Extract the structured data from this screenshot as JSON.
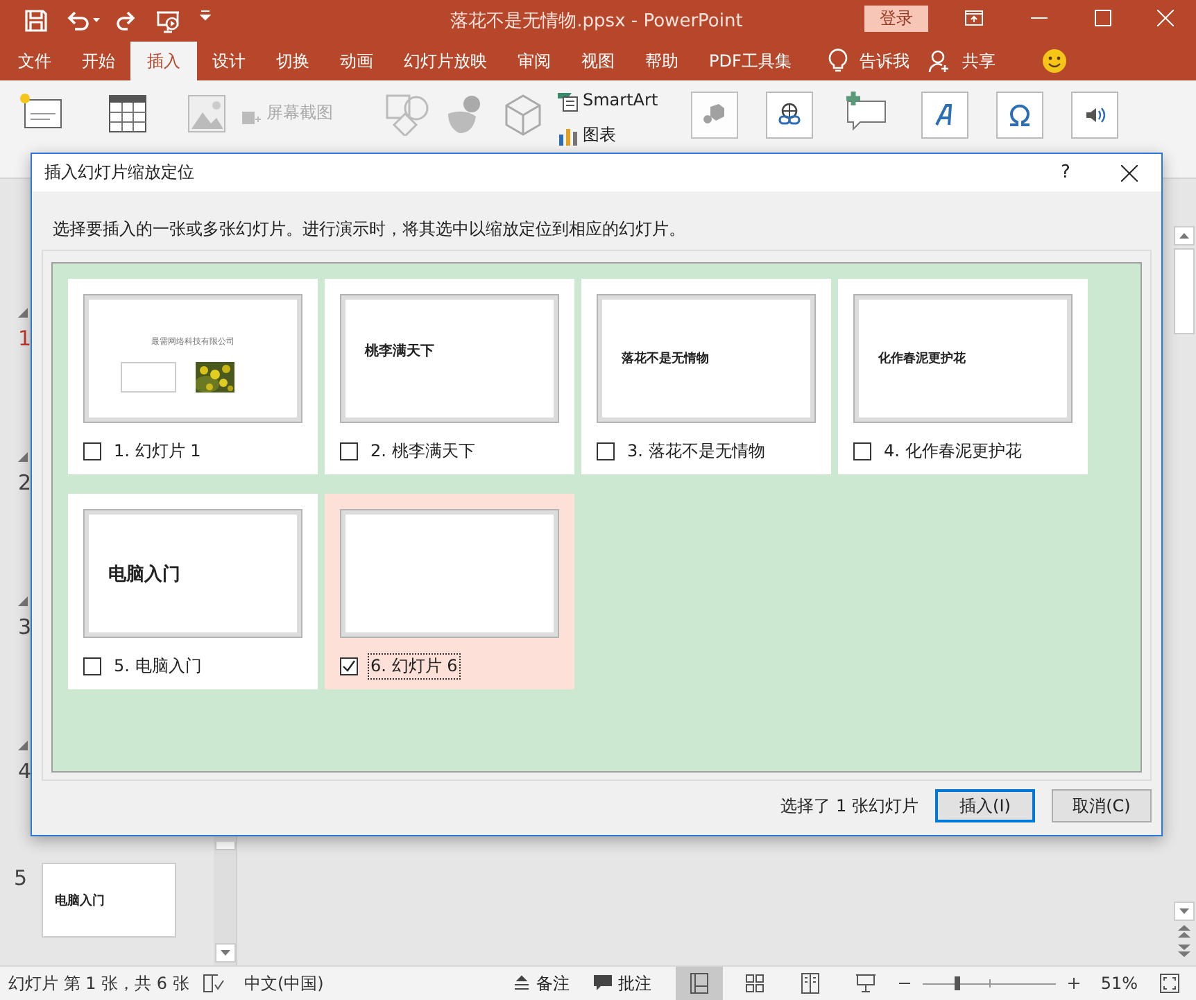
{
  "window": {
    "title": "落花不是无情物.ppsx  -  PowerPoint",
    "sign_in": "登录"
  },
  "menu_tabs": [
    {
      "label": "文件",
      "selected": false
    },
    {
      "label": "开始",
      "selected": false
    },
    {
      "label": "插入",
      "selected": true
    },
    {
      "label": "设计",
      "selected": false
    },
    {
      "label": "切换",
      "selected": false
    },
    {
      "label": "动画",
      "selected": false
    },
    {
      "label": "幻灯片放映",
      "selected": false
    },
    {
      "label": "审阅",
      "selected": false
    },
    {
      "label": "视图",
      "selected": false
    },
    {
      "label": "帮助",
      "selected": false
    },
    {
      "label": "PDF工具集",
      "selected": false
    }
  ],
  "tell_me": "告诉我",
  "share": "共享",
  "ribbon": {
    "screenshot": "屏幕截图",
    "smartart": "SmartArt",
    "chart": "图表"
  },
  "slide_pane": {
    "numbers": [
      {
        "number": "1",
        "selected": true
      },
      {
        "number": "2",
        "selected": false
      },
      {
        "number": "3",
        "selected": false
      },
      {
        "number": "4",
        "selected": false
      }
    ],
    "last": {
      "number": "5",
      "title": "电脑入门"
    }
  },
  "dialog": {
    "title": "插入幻灯片缩放定位",
    "help": "?",
    "instruction": "选择要插入的一张或多张幻灯片。进行演示时，将其选中以缩放定位到相应的幻灯片。",
    "slides": [
      {
        "kind": "title-picture",
        "title": "最需网络科技有限公司",
        "label": "1. 幻灯片 1",
        "checked": false
      },
      {
        "kind": "title",
        "title": "桃李满天下",
        "label": "2. 桃李满天下",
        "checked": false
      },
      {
        "kind": "title",
        "title": "落花不是无情物",
        "label": "3. 落花不是无情物",
        "checked": false
      },
      {
        "kind": "title",
        "title": "化作春泥更护花",
        "label": "4. 化作春泥更护花",
        "checked": false
      },
      {
        "kind": "title",
        "title": "电脑入门",
        "label": "5. 电脑入门",
        "checked": false
      },
      {
        "kind": "blank",
        "label": "6. 幻灯片 6",
        "checked": true
      }
    ],
    "summary": "选择了 1 张幻灯片",
    "buttons": [
      {
        "label": "插入(I)",
        "default": true
      },
      {
        "label": "取消(C)",
        "default": false
      }
    ]
  },
  "status_bar": {
    "slide_info": "幻灯片 第 1 张，共 6 张",
    "language": "中文(中国)",
    "notes": "备注",
    "comments": "批注",
    "zoom": "51%",
    "zoom_slider": {
      "level": 0.24
    }
  }
}
